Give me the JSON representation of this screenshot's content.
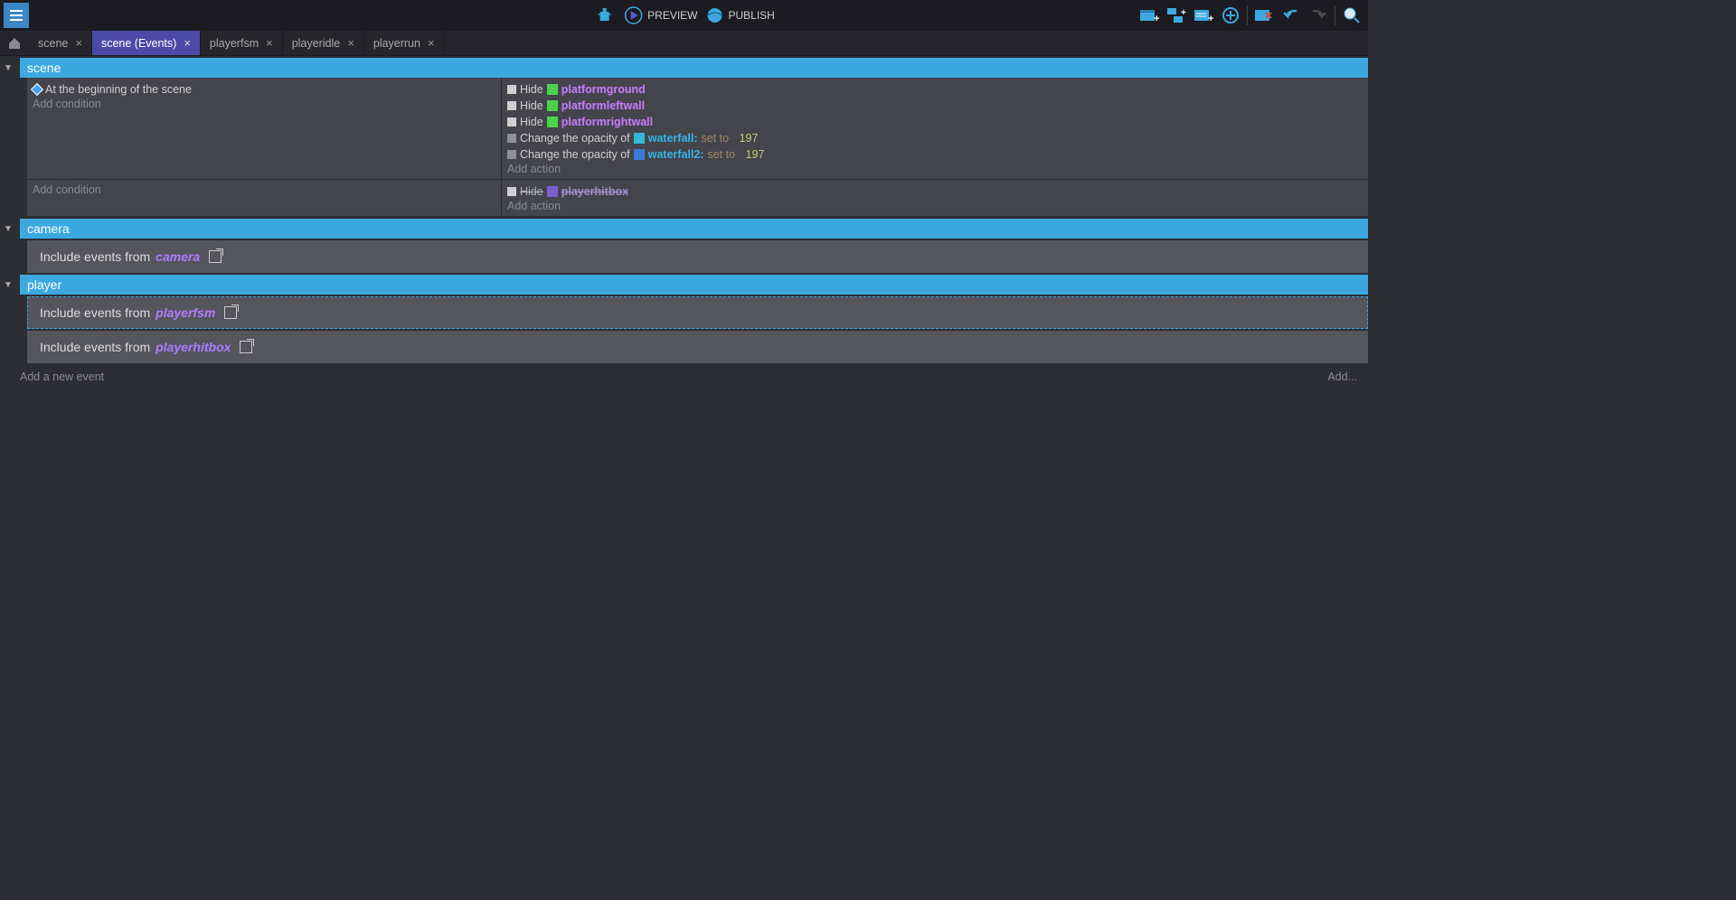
{
  "topbar": {
    "preview": "PREVIEW",
    "publish": "PUBLISH"
  },
  "tabs": [
    {
      "label": "scene",
      "active": false
    },
    {
      "label": "scene (Events)",
      "active": true
    },
    {
      "label": "playerfsm",
      "active": false
    },
    {
      "label": "playeridle",
      "active": false
    },
    {
      "label": "playerrun",
      "active": false
    }
  ],
  "groups": {
    "scene": {
      "title": "scene",
      "event1": {
        "condition": "At the beginning of the scene",
        "add_condition": "Add condition",
        "actions": [
          {
            "verb": "Hide",
            "swatch": "swatch-green",
            "obj": "platformground"
          },
          {
            "verb": "Hide",
            "swatch": "swatch-green",
            "obj": "platformleftwall"
          },
          {
            "verb": "Hide",
            "swatch": "swatch-green",
            "obj": "platformrightwall"
          }
        ],
        "opacity_actions": [
          {
            "text": "Change the opacity of",
            "swatch": "swatch-cyan",
            "obj": "waterfall",
            "op": "set to",
            "val": "197"
          },
          {
            "text": "Change the opacity of",
            "swatch": "swatch-blue",
            "obj": "waterfall2",
            "op": "set to",
            "val": "197"
          }
        ],
        "add_action": "Add action"
      },
      "event2": {
        "add_condition": "Add condition",
        "disabled_action": {
          "verb": "Hide",
          "obj": "playerhitbox"
        },
        "add_action": "Add action"
      }
    },
    "camera": {
      "title": "camera",
      "include_text": "Include events from",
      "include_link": "camera"
    },
    "player": {
      "title": "player",
      "include1": {
        "text": "Include events from",
        "link": "playerfsm"
      },
      "include2": {
        "text": "Include events from",
        "link": "playerhitbox"
      }
    }
  },
  "footer": {
    "add_event": "Add a new event",
    "add_right": "Add..."
  }
}
